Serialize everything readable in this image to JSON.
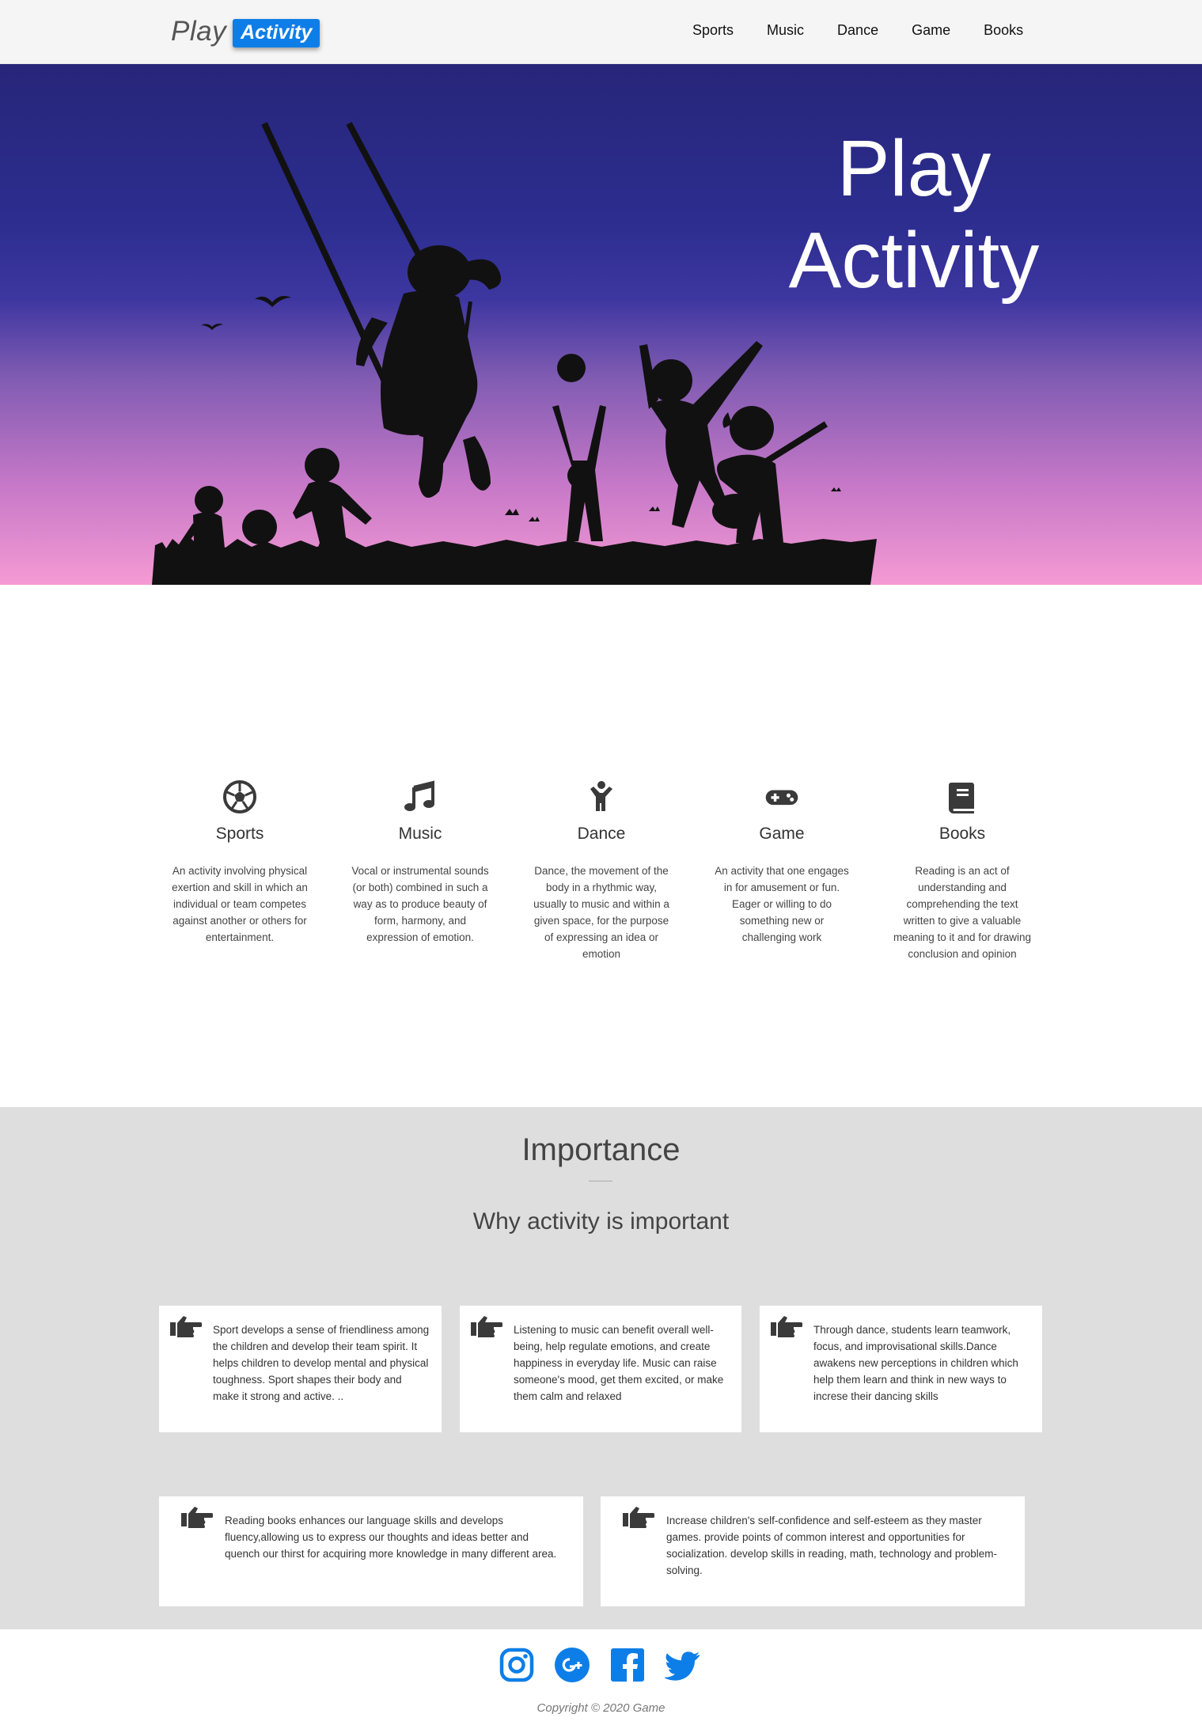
{
  "brand": {
    "play": "Play",
    "activity": "Activity"
  },
  "nav": {
    "links": [
      "Sports",
      "Music",
      "Dance",
      "Game",
      "Books"
    ]
  },
  "hero": {
    "title_line1": "Play",
    "title_line2": "Activity"
  },
  "features": [
    {
      "icon": "soccer-ball-icon",
      "title": "Sports",
      "text": "An activity involving physical exertion and skill in which an individual or team competes against another or others for entertainment."
    },
    {
      "icon": "music-note-icon",
      "title": "Music",
      "text": "Vocal or instrumental sounds (or both) combined in such a way as to produce beauty of form, harmony, and expression of emotion."
    },
    {
      "icon": "child-icon",
      "title": "Dance",
      "text": "Dance, the movement of the body in a rhythmic way, usually to music and within a given space, for the purpose of expressing an idea or emotion"
    },
    {
      "icon": "gamepad-icon",
      "title": "Game",
      "text": "An activity that one engages in for amusement or fun. Eager or willing to do something new or challenging work"
    },
    {
      "icon": "book-icon",
      "title": "Books",
      "text": "Reading is an act of understanding and comprehending the text written to give a valuable meaning to it and for drawing conclusion and opinion"
    }
  ],
  "importance": {
    "title": "Importance",
    "subtitle": "Why activity is important",
    "cards": [
      "Sport develops a sense of friendliness among the children and develop their team spirit. It helps children to develop mental and physical toughness. Sport shapes their body and make it strong and active. ..",
      "Listening to music can benefit overall well-being, help regulate emotions, and create happiness in everyday life. Music can raise someone's mood, get them excited, or make them calm and relaxed",
      "Through dance, students learn teamwork, focus, and improvisational skills.Dance awakens new perceptions in children which help them learn and think in new ways to increse their dancing skills",
      "Reading books enhances our language skills and develops fluency,allowing us to express our thoughts and ideas better and quench our thirst for acquiring more knowledge in many different area.",
      "Increase children's self-confidence and self-esteem as they master games. provide points of common interest and opportunities for socialization. develop skills in reading, math, technology and problem-solving."
    ]
  },
  "footer": {
    "social": [
      "instagram-icon",
      "google-plus-icon",
      "facebook-icon",
      "twitter-icon"
    ],
    "copyright": "Copyright © 2020 Game"
  },
  "colors": {
    "accent": "#0d7ee8",
    "hero_top": "#27267a",
    "hero_bottom": "#f59ad4",
    "importance_bg": "#dedede",
    "icon": "#3a3a3a"
  }
}
